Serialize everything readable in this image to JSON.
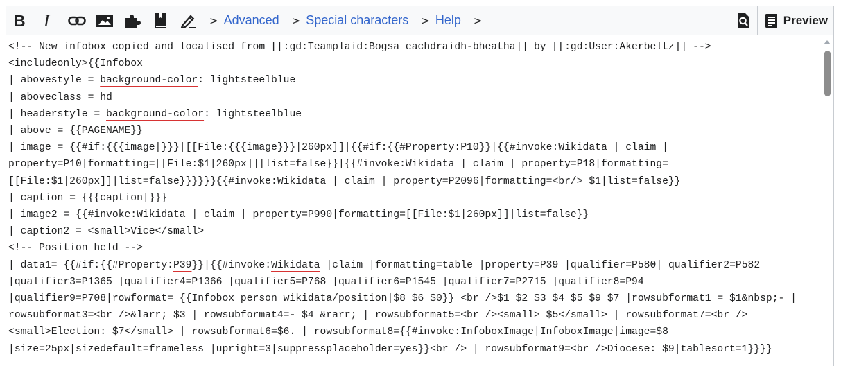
{
  "toolbar": {
    "format_buttons": [
      {
        "icon": "bold-icon",
        "label": "Bold"
      },
      {
        "icon": "italic-icon",
        "label": "Italic"
      }
    ],
    "insert_buttons": [
      {
        "icon": "link-icon"
      },
      {
        "icon": "image-icon"
      },
      {
        "icon": "puzzle-icon"
      },
      {
        "icon": "book-icon"
      },
      {
        "icon": "signature-icon"
      }
    ],
    "sections": [
      {
        "label": "Advanced"
      },
      {
        "label": "Special characters"
      },
      {
        "label": "Help"
      }
    ],
    "right": {
      "search_replace_icon": "search-replace-icon",
      "preview_label": "Preview"
    }
  },
  "editor": {
    "lines": [
      "<!-- New infobox copied and localised from [[:gd:Teamplaid:Bogsa eachdraidh-bheatha]] by [[:gd:User:Akerbeltz]] -->",
      "<includeonly>{{Infobox",
      "| abovestyle = background-color: lightsteelblue",
      "| aboveclass = hd",
      "| headerstyle = background-color: lightsteelblue",
      "| above = {{PAGENAME}}",
      "| image = {{#if:{{{image|}}}|[[File:{{{image}}}|260px]]|{{#if:{{#Property:P10}}|{{#invoke:Wikidata | claim |",
      "property=P10|formatting=[[File:$1|260px]]|list=false}}|{{#invoke:Wikidata | claim | property=P18|formatting=",
      "[[File:$1|260px]]|list=false}}}}}}{{#invoke:Wikidata | claim | property=P2096|formatting=<br/> $1|list=false}}",
      "| caption = {{{caption|}}}",
      "| image2 = {{#invoke:Wikidata | claim | property=P990|formatting=[[File:$1|260px]]|list=false}}",
      "| caption2 = <small>Vice</small>",
      "<!-- Position held -->",
      "| data1= {{#if:{{#Property:P39}}|{{#invoke:Wikidata |claim |formatting=table |property=P39 |qualifier=P580| qualifier2=P582",
      "|qualifier3=P1365 |qualifier4=P1366 |qualifier5=P768 |qualifier6=P1545 |qualifier7=P2715 |qualifier8=P94",
      "|qualifier9=P708|rowformat= {{Infobox person wikidata/position|$8 $6 $0}} <br />$1 $2 $3 $4 $5 $9 $7 |rowsubformat1 = $1&nbsp;- |",
      "rowsubformat3=<br />&larr; $3 | rowsubformat4=- $4 &rarr; | rowsubformat5=<br /><small> $5</small> | rowsubformat7=<br />",
      "<small>Election: $7</small> | rowsubformat6=$6. | rowsubformat8={{#invoke:InfoboxImage|InfoboxImage|image=$8",
      "|size=25px|sizedefault=frameless |upright=3|suppressplaceholder=yes}}<br /> | rowsubformat9=<br />Diocese: $9|tablesort=1}}}}"
    ],
    "spellcheck_words": [
      {
        "line": 2,
        "text": "background-color"
      },
      {
        "line": 4,
        "text": "background-color"
      },
      {
        "line": 13,
        "text": "P39"
      },
      {
        "line": 13,
        "text": "Wikidata"
      }
    ]
  }
}
